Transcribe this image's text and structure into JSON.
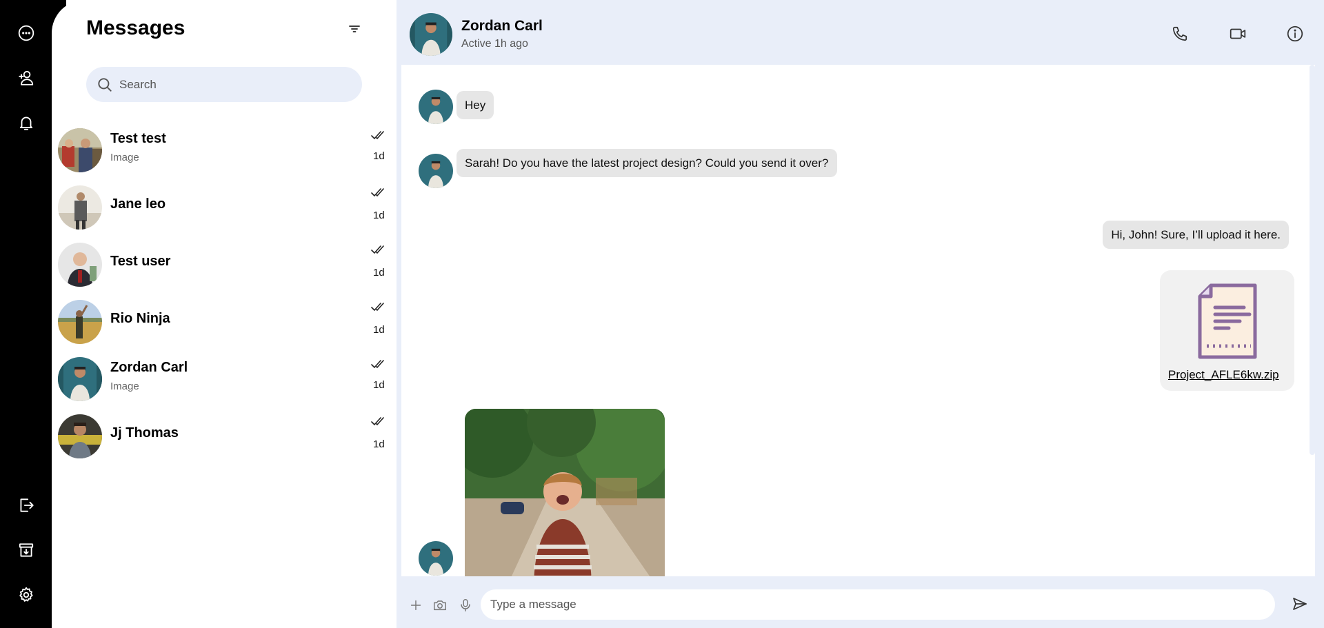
{
  "sidebar": {
    "icons": [
      "messages-icon",
      "add-contact-icon",
      "notifications-icon",
      "logout-icon",
      "archive-icon",
      "settings-icon"
    ]
  },
  "panel": {
    "title": "Messages",
    "search_placeholder": "Search"
  },
  "chats": [
    {
      "name": "Test test",
      "preview": "Image",
      "time": "1d"
    },
    {
      "name": "Jane leo",
      "preview": "",
      "time": "1d"
    },
    {
      "name": "Test user",
      "preview": "",
      "time": "1d"
    },
    {
      "name": "Rio Ninja",
      "preview": "",
      "time": "1d"
    },
    {
      "name": "Zordan Carl",
      "preview": "Image",
      "time": "1d"
    },
    {
      "name": "Jj Thomas",
      "preview": "",
      "time": "1d"
    }
  ],
  "conversation": {
    "name": "Zordan Carl",
    "status": "Active 1h ago",
    "messages": [
      {
        "from": "them",
        "text": "Hey"
      },
      {
        "from": "them",
        "text": "Sarah! Do you have the latest project design? Could you send it over?"
      },
      {
        "from": "me",
        "text": "Hi, John! Sure, I’ll upload it here."
      },
      {
        "from": "me",
        "type": "file",
        "text": "Project_AFLE6kw.zip"
      },
      {
        "from": "them",
        "type": "image"
      }
    ]
  },
  "composer": {
    "placeholder": "Type a message"
  },
  "colors": {
    "rail": "#000000",
    "conversation_bg": "#e9eef9",
    "bubble": "#e6e6e6",
    "file_icon": "#8a6a9e"
  }
}
